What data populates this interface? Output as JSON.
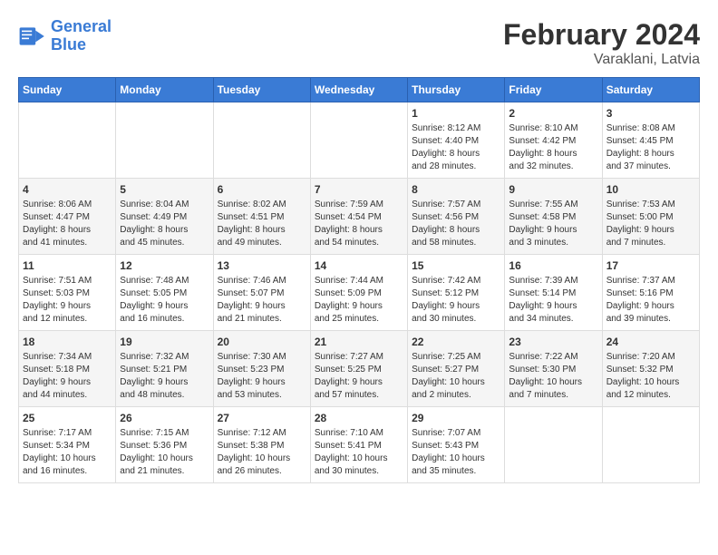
{
  "header": {
    "logo_general": "General",
    "logo_blue": "Blue",
    "title": "February 2024",
    "subtitle": "Varaklani, Latvia"
  },
  "days_of_week": [
    "Sunday",
    "Monday",
    "Tuesday",
    "Wednesday",
    "Thursday",
    "Friday",
    "Saturday"
  ],
  "weeks": [
    [
      {
        "day": "",
        "content": ""
      },
      {
        "day": "",
        "content": ""
      },
      {
        "day": "",
        "content": ""
      },
      {
        "day": "",
        "content": ""
      },
      {
        "day": "1",
        "content": "Sunrise: 8:12 AM\nSunset: 4:40 PM\nDaylight: 8 hours\nand 28 minutes."
      },
      {
        "day": "2",
        "content": "Sunrise: 8:10 AM\nSunset: 4:42 PM\nDaylight: 8 hours\nand 32 minutes."
      },
      {
        "day": "3",
        "content": "Sunrise: 8:08 AM\nSunset: 4:45 PM\nDaylight: 8 hours\nand 37 minutes."
      }
    ],
    [
      {
        "day": "4",
        "content": "Sunrise: 8:06 AM\nSunset: 4:47 PM\nDaylight: 8 hours\nand 41 minutes."
      },
      {
        "day": "5",
        "content": "Sunrise: 8:04 AM\nSunset: 4:49 PM\nDaylight: 8 hours\nand 45 minutes."
      },
      {
        "day": "6",
        "content": "Sunrise: 8:02 AM\nSunset: 4:51 PM\nDaylight: 8 hours\nand 49 minutes."
      },
      {
        "day": "7",
        "content": "Sunrise: 7:59 AM\nSunset: 4:54 PM\nDaylight: 8 hours\nand 54 minutes."
      },
      {
        "day": "8",
        "content": "Sunrise: 7:57 AM\nSunset: 4:56 PM\nDaylight: 8 hours\nand 58 minutes."
      },
      {
        "day": "9",
        "content": "Sunrise: 7:55 AM\nSunset: 4:58 PM\nDaylight: 9 hours\nand 3 minutes."
      },
      {
        "day": "10",
        "content": "Sunrise: 7:53 AM\nSunset: 5:00 PM\nDaylight: 9 hours\nand 7 minutes."
      }
    ],
    [
      {
        "day": "11",
        "content": "Sunrise: 7:51 AM\nSunset: 5:03 PM\nDaylight: 9 hours\nand 12 minutes."
      },
      {
        "day": "12",
        "content": "Sunrise: 7:48 AM\nSunset: 5:05 PM\nDaylight: 9 hours\nand 16 minutes."
      },
      {
        "day": "13",
        "content": "Sunrise: 7:46 AM\nSunset: 5:07 PM\nDaylight: 9 hours\nand 21 minutes."
      },
      {
        "day": "14",
        "content": "Sunrise: 7:44 AM\nSunset: 5:09 PM\nDaylight: 9 hours\nand 25 minutes."
      },
      {
        "day": "15",
        "content": "Sunrise: 7:42 AM\nSunset: 5:12 PM\nDaylight: 9 hours\nand 30 minutes."
      },
      {
        "day": "16",
        "content": "Sunrise: 7:39 AM\nSunset: 5:14 PM\nDaylight: 9 hours\nand 34 minutes."
      },
      {
        "day": "17",
        "content": "Sunrise: 7:37 AM\nSunset: 5:16 PM\nDaylight: 9 hours\nand 39 minutes."
      }
    ],
    [
      {
        "day": "18",
        "content": "Sunrise: 7:34 AM\nSunset: 5:18 PM\nDaylight: 9 hours\nand 44 minutes."
      },
      {
        "day": "19",
        "content": "Sunrise: 7:32 AM\nSunset: 5:21 PM\nDaylight: 9 hours\nand 48 minutes."
      },
      {
        "day": "20",
        "content": "Sunrise: 7:30 AM\nSunset: 5:23 PM\nDaylight: 9 hours\nand 53 minutes."
      },
      {
        "day": "21",
        "content": "Sunrise: 7:27 AM\nSunset: 5:25 PM\nDaylight: 9 hours\nand 57 minutes."
      },
      {
        "day": "22",
        "content": "Sunrise: 7:25 AM\nSunset: 5:27 PM\nDaylight: 10 hours\nand 2 minutes."
      },
      {
        "day": "23",
        "content": "Sunrise: 7:22 AM\nSunset: 5:30 PM\nDaylight: 10 hours\nand 7 minutes."
      },
      {
        "day": "24",
        "content": "Sunrise: 7:20 AM\nSunset: 5:32 PM\nDaylight: 10 hours\nand 12 minutes."
      }
    ],
    [
      {
        "day": "25",
        "content": "Sunrise: 7:17 AM\nSunset: 5:34 PM\nDaylight: 10 hours\nand 16 minutes."
      },
      {
        "day": "26",
        "content": "Sunrise: 7:15 AM\nSunset: 5:36 PM\nDaylight: 10 hours\nand 21 minutes."
      },
      {
        "day": "27",
        "content": "Sunrise: 7:12 AM\nSunset: 5:38 PM\nDaylight: 10 hours\nand 26 minutes."
      },
      {
        "day": "28",
        "content": "Sunrise: 7:10 AM\nSunset: 5:41 PM\nDaylight: 10 hours\nand 30 minutes."
      },
      {
        "day": "29",
        "content": "Sunrise: 7:07 AM\nSunset: 5:43 PM\nDaylight: 10 hours\nand 35 minutes."
      },
      {
        "day": "",
        "content": ""
      },
      {
        "day": "",
        "content": ""
      }
    ]
  ]
}
